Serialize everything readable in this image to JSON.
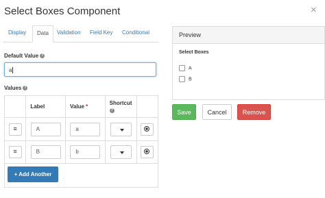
{
  "dialog": {
    "title": "Select Boxes Component",
    "close": "×"
  },
  "tabs": [
    {
      "label": "Display",
      "active": false
    },
    {
      "label": "Data",
      "active": true
    },
    {
      "label": "Validation",
      "active": false
    },
    {
      "label": "Field Key",
      "active": false
    },
    {
      "label": "Conditional",
      "active": false
    }
  ],
  "default_value": {
    "label": "Default Value",
    "help": "?",
    "value": "a"
  },
  "values": {
    "label": "Values",
    "help": "?",
    "columns": {
      "label": "Label",
      "value": "Value",
      "value_required": "*",
      "shortcut": "Shortcut",
      "shortcut_help": "?"
    },
    "rows": [
      {
        "drag": "≡",
        "label": "A",
        "value": "a"
      },
      {
        "drag": "≡",
        "label": "B",
        "value": "b"
      }
    ],
    "add_button": "+ Add Another"
  },
  "preview": {
    "title": "Preview",
    "field_label": "Select Boxes",
    "options": [
      "A",
      "B"
    ]
  },
  "actions": {
    "save": "Save",
    "cancel": "Cancel",
    "remove": "Remove"
  },
  "colors": {
    "primary": "#337ab7",
    "success": "#5cb85c",
    "danger": "#d9534f"
  }
}
